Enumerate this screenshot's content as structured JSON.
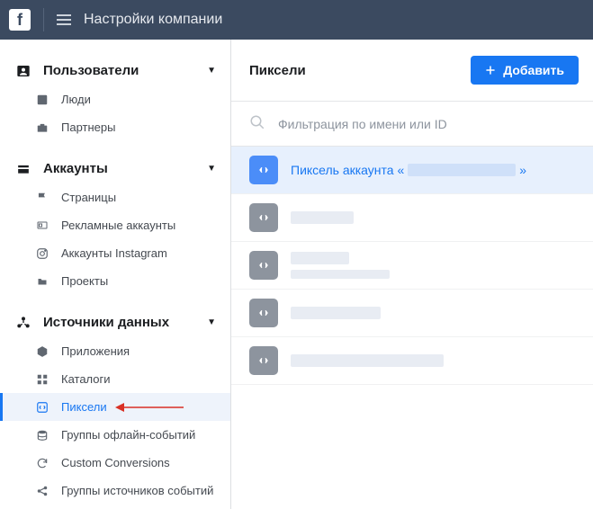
{
  "topbar": {
    "title": "Настройки компании"
  },
  "sidebar": {
    "sections": [
      {
        "label": "Пользователи",
        "items": [
          {
            "label": "Люди"
          },
          {
            "label": "Партнеры"
          }
        ]
      },
      {
        "label": "Аккаунты",
        "items": [
          {
            "label": "Страницы"
          },
          {
            "label": "Рекламные аккаунты"
          },
          {
            "label": "Аккаунты Instagram"
          },
          {
            "label": "Проекты"
          }
        ]
      },
      {
        "label": "Источники данных",
        "items": [
          {
            "label": "Приложения"
          },
          {
            "label": "Каталоги"
          },
          {
            "label": "Пиксели"
          },
          {
            "label": "Группы офлайн-событий"
          },
          {
            "label": "Custom Conversions"
          },
          {
            "label": "Группы источников событий"
          }
        ]
      }
    ]
  },
  "main": {
    "title": "Пиксели",
    "add_label": "Добавить",
    "search_placeholder": "Фильтрация по имени или ID",
    "selected_prefix": "Пиксель аккаунта «",
    "selected_suffix": "»"
  }
}
